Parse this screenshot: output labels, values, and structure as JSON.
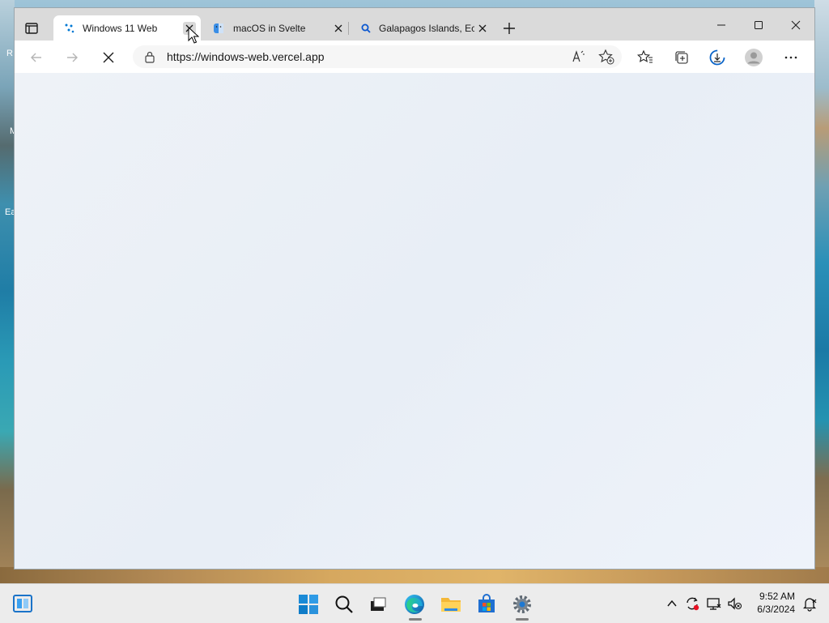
{
  "desktop": {
    "labels": [
      {
        "text": "R"
      },
      {
        "text": "M"
      },
      {
        "text": "Ea"
      }
    ]
  },
  "browser": {
    "tabs": [
      {
        "label": "Windows 11 Web",
        "active": true,
        "favicon": "win11-dots-icon"
      },
      {
        "label": "macOS in Svelte",
        "active": false,
        "favicon": "finder-icon"
      },
      {
        "label": "Galapagos Islands, Ec",
        "active": false,
        "favicon": "search-icon"
      }
    ],
    "address": {
      "url": "https://windows-web.vercel.app"
    },
    "window_controls": [
      "minimize",
      "maximize",
      "close"
    ]
  },
  "taskbar": {
    "clock": {
      "time": "9:52 AM",
      "date": "6/3/2024"
    },
    "apps": [
      "start",
      "search",
      "task-view",
      "edge",
      "file-explorer",
      "store",
      "settings"
    ],
    "running": [
      "edge",
      "settings"
    ]
  },
  "colors": {
    "accent": "#0078d4",
    "tab_strip": "#dadada",
    "content_bg": "#eef2f7",
    "taskbar": "#ececec"
  }
}
